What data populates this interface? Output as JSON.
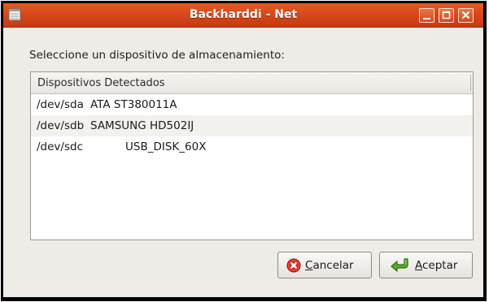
{
  "window": {
    "title": "Backharddi - Net",
    "controls": [
      "minimize-icon",
      "maximize-icon",
      "close-icon"
    ],
    "accent_color": "#d4461a"
  },
  "prompt": "Seleccione un dispositivo de almacenamiento:",
  "device_list": {
    "header": "Dispositivos Detectados",
    "rows": [
      {
        "device": "/dev/sda",
        "model": "ATA ST380011A"
      },
      {
        "device": "/dev/sdb",
        "model": "SAMSUNG HD502IJ"
      },
      {
        "device": "/dev/sdc",
        "model": "USB_DISK_60X"
      }
    ]
  },
  "buttons": {
    "cancel": {
      "mnemonic": "C",
      "rest": "ancelar",
      "icon": "cancel-icon"
    },
    "accept": {
      "mnemonic": "A",
      "rest": "ceptar",
      "icon": "accept-arrow-icon"
    }
  }
}
